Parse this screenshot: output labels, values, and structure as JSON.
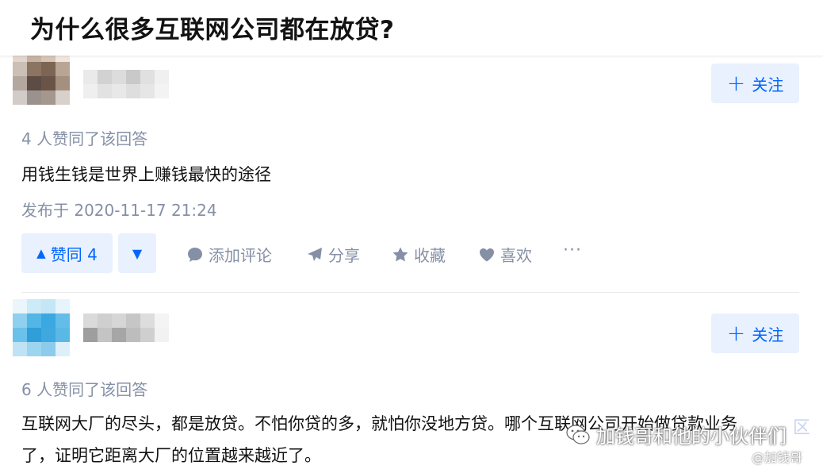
{
  "question": {
    "title": "为什么很多互联网公司都在放贷?"
  },
  "answers": [
    {
      "follow_label": "关注",
      "voters": "4 人赞同了该回答",
      "content": "用钱生钱是世界上赚钱最快的途径",
      "published": "发布于 2020-11-17 21:24",
      "vote_up_label": "赞同 4",
      "actions": {
        "comment": "添加评论",
        "share": "分享",
        "collect": "收藏",
        "like": "喜欢"
      },
      "more": "···"
    },
    {
      "follow_label": "关注",
      "voters": "6 人赞同了该回答",
      "content_line1": "互联网大厂的尽头，都是放贷。不怕你贷的多，就怕你没地方贷。哪个互联网公司开始做贷款业务",
      "content_line2": "了，证明它距离大厂的位置越来越近了。"
    }
  ],
  "watermark": {
    "text": "加钱哥和他的小伙伴们",
    "handle": "@加钱哥",
    "ghost": "区"
  },
  "colors": {
    "accent": "#0066ff",
    "accent_bg": "#e8f1fd",
    "muted": "#8590a6",
    "text": "#121212"
  },
  "icons": {
    "follow": "plus-icon",
    "vote_up": "triangle-up-icon",
    "vote_down": "triangle-down-icon",
    "comment": "comment-bubble-icon",
    "share": "paper-plane-icon",
    "collect": "star-icon",
    "like": "heart-icon",
    "watermark": "wechat-icon"
  }
}
